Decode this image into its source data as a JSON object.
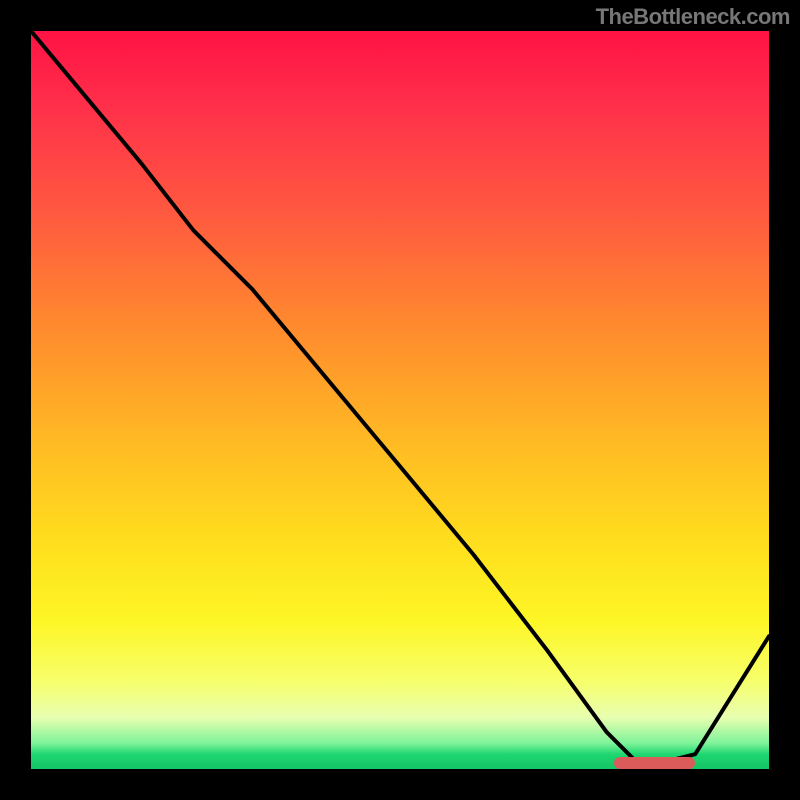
{
  "attribution": "TheBottleneck.com",
  "colors": {
    "background": "#000000",
    "line": "#000000",
    "marker": "#db5a5a",
    "gradient_top": "#ff1244",
    "gradient_bottom": "#14c565"
  },
  "chart_data": {
    "type": "line",
    "title": "",
    "xlabel": "",
    "ylabel": "",
    "xlim": [
      0,
      100
    ],
    "ylim": [
      0,
      100
    ],
    "notes": "Black curve over red→yellow→green vertical gradient; minimum plateau near x≈80–90 where a salmon marker sits at y≈0.",
    "series": [
      {
        "name": "curve",
        "x": [
          0,
          5,
          15,
          22,
          25,
          30,
          40,
          50,
          60,
          70,
          78,
          82,
          86,
          90,
          95,
          100
        ],
        "values": [
          100,
          94,
          82,
          73,
          70,
          65,
          53,
          41,
          29,
          16,
          5,
          1,
          1,
          2,
          10,
          18
        ]
      }
    ],
    "marker": {
      "x_start": 79,
      "x_end": 90,
      "y": 0.8
    }
  }
}
